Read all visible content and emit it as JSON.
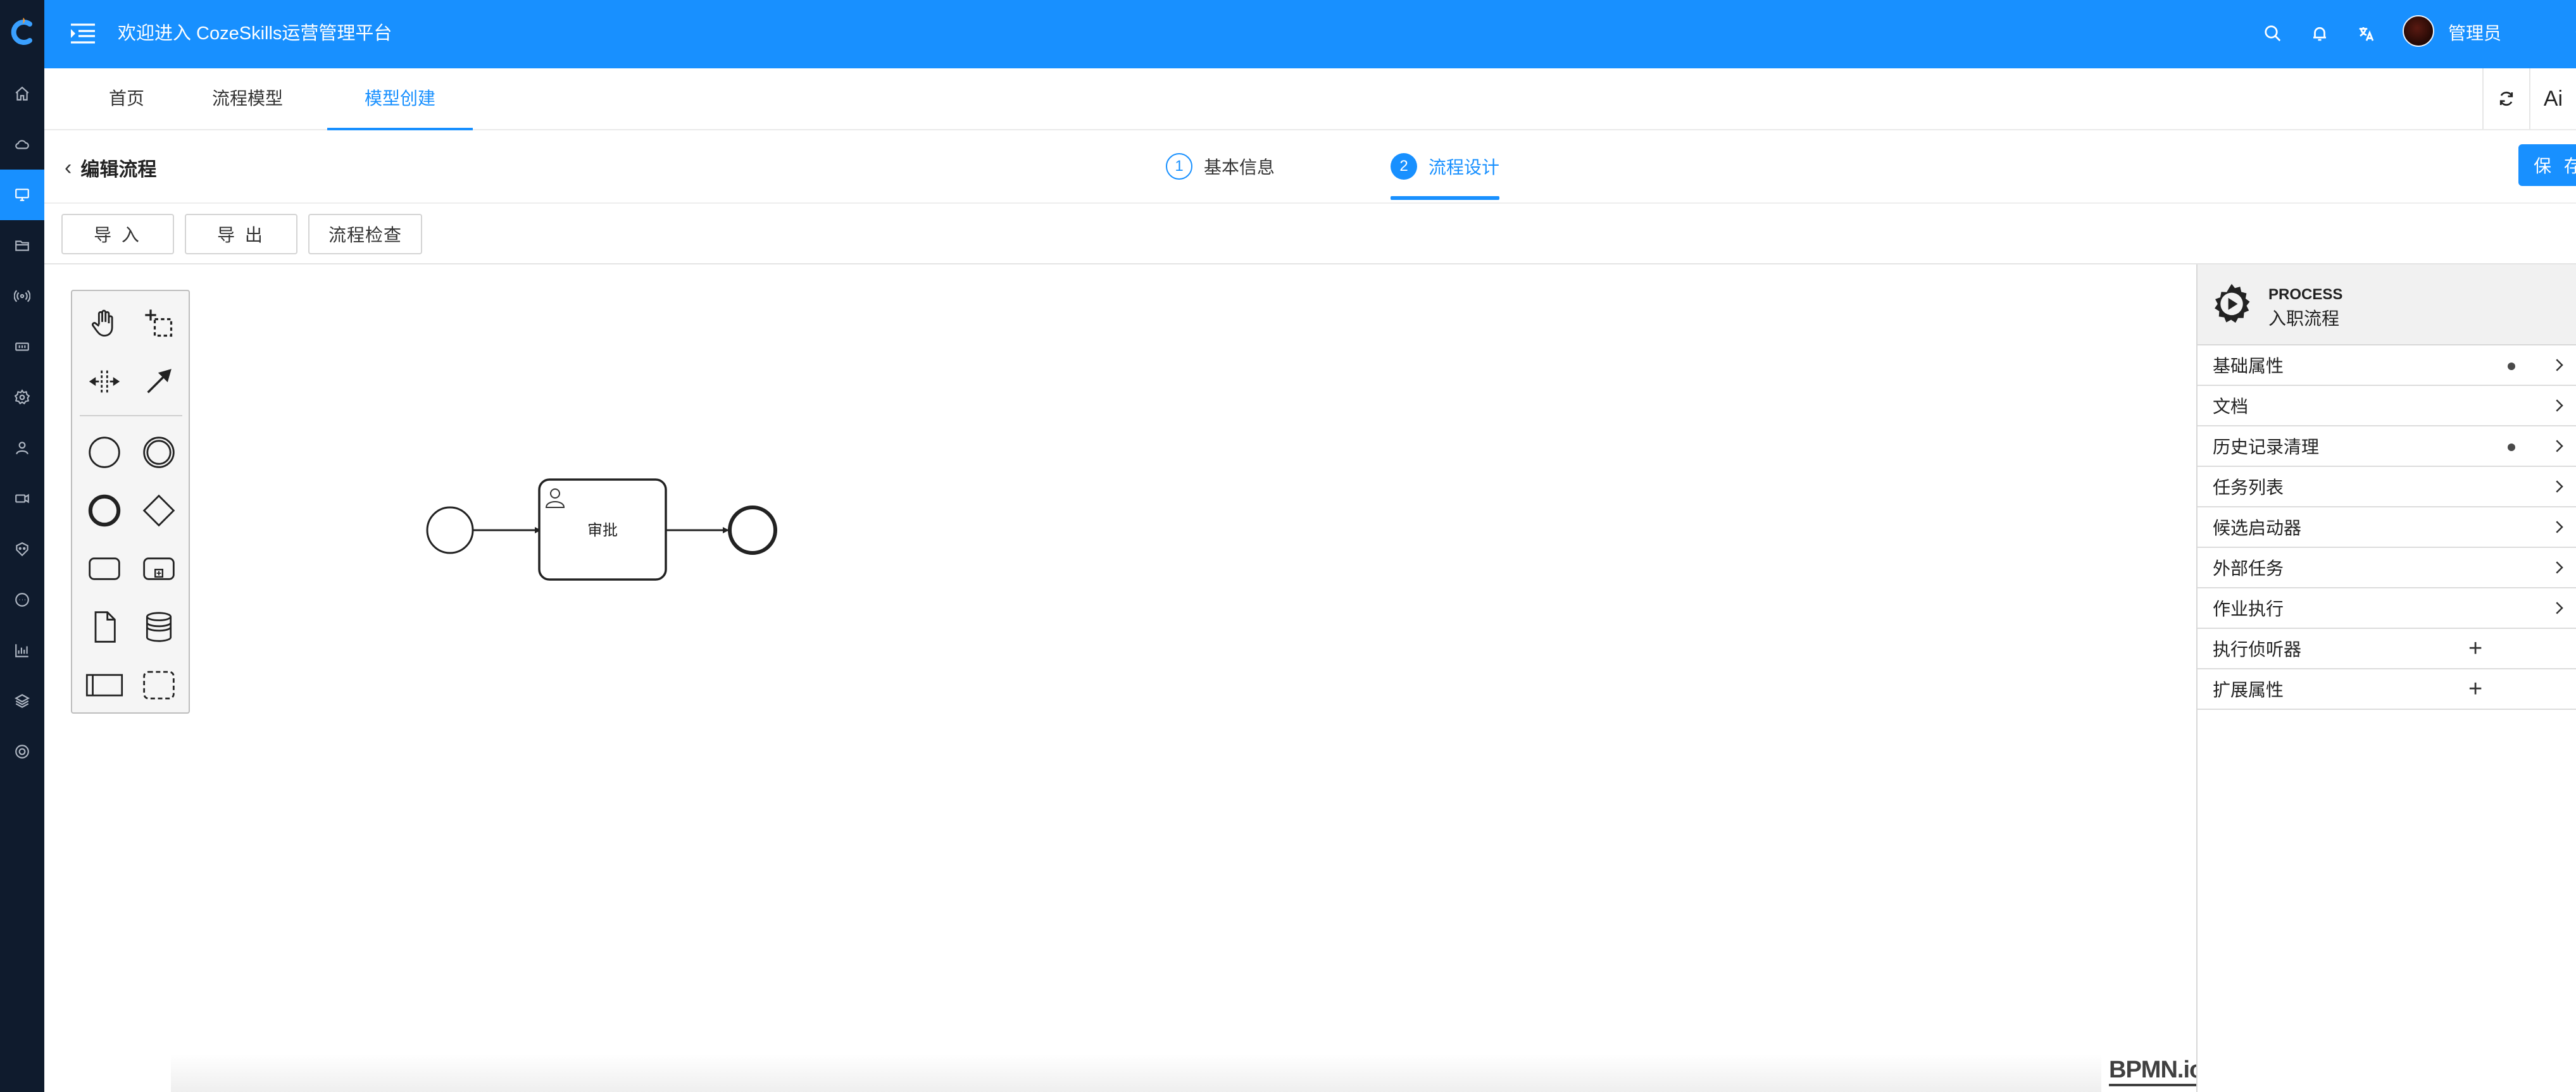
{
  "header": {
    "title": "欢迎进入 CozeSkills运营管理平台",
    "username": "管理员",
    "icons": [
      "menu-fold-icon",
      "search-icon",
      "bell-icon",
      "translate-icon",
      "settings-icon"
    ]
  },
  "sidebar": {
    "icons": [
      "home-icon",
      "cloud-icon",
      "monitor-icon",
      "folder-icon",
      "broadcast-icon",
      "tag-icon",
      "settings-icon",
      "user-icon",
      "video-icon",
      "robot-icon",
      "chat-icon",
      "chart-icon",
      "layers-icon",
      "aperture-icon"
    ]
  },
  "tabs": {
    "items": [
      "首页",
      "流程模型",
      "模型创建"
    ],
    "active": "模型创建",
    "right_tools": {
      "ai_label": "Ai"
    }
  },
  "editor": {
    "back_label": "编辑流程",
    "steps": [
      {
        "num": "1",
        "label": "基本信息",
        "state": "done"
      },
      {
        "num": "2",
        "label": "流程设计",
        "state": "current"
      }
    ],
    "save_label": "保 存"
  },
  "toolbar": {
    "import_label": "导 入",
    "export_label": "导 出",
    "check_label": "流程检查"
  },
  "diagram": {
    "task_label": "审批",
    "watermark": "BPMN.io"
  },
  "properties": {
    "element_type": "PROCESS",
    "element_name": "入职流程",
    "groups": [
      {
        "label": "基础属性",
        "has_dot": true,
        "action": "expand"
      },
      {
        "label": "文档",
        "has_dot": false,
        "action": "expand"
      },
      {
        "label": "历史记录清理",
        "has_dot": true,
        "action": "expand"
      },
      {
        "label": "任务列表",
        "has_dot": false,
        "action": "expand"
      },
      {
        "label": "候选启动器",
        "has_dot": false,
        "action": "expand"
      },
      {
        "label": "外部任务",
        "has_dot": false,
        "action": "expand"
      },
      {
        "label": "作业执行",
        "has_dot": false,
        "action": "expand"
      },
      {
        "label": "执行侦听器",
        "has_dot": false,
        "action": "add"
      },
      {
        "label": "扩展属性",
        "has_dot": false,
        "action": "add"
      }
    ]
  },
  "colors": {
    "primary": "#1890ff",
    "rail": "#0f1b2d"
  }
}
